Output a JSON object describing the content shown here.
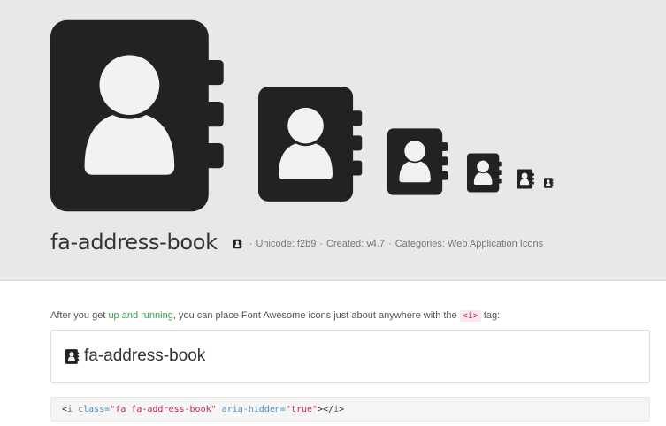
{
  "hero": {
    "icon_name": "address-book-icon",
    "title": "fa-address-book",
    "meta": {
      "unicode": "Unicode: f2b9",
      "created": "Created: v4.7",
      "categories": "Categories: Web Application Icons",
      "separator": "·"
    },
    "colors": {
      "background": "#e8e8e8",
      "icon": "#222222"
    }
  },
  "intro": {
    "before": "After you get ",
    "link": "up and running",
    "after": ", you can place Font Awesome icons just about anywhere with the ",
    "tag": "<i>",
    "end": " tag:"
  },
  "example": {
    "label": "fa-address-book"
  },
  "code": {
    "open_lt": "<",
    "tag": "i",
    "attr1": " class=",
    "val1": "\"fa fa-address-book\"",
    "attr2": " aria-hidden=",
    "val2": "\"true\"",
    "close": "></",
    "close_tag": "i",
    "close_gt": ">"
  }
}
